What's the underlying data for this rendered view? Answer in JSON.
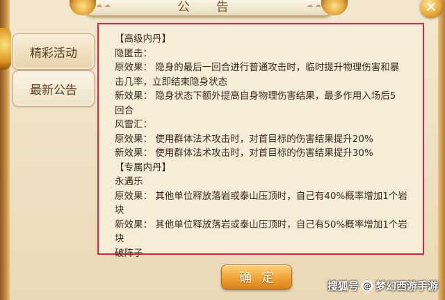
{
  "window": {
    "title": "公 告",
    "close_label": "✕"
  },
  "sidebar": {
    "tabs": [
      {
        "label": "精彩活动"
      },
      {
        "label": "最新公告"
      }
    ]
  },
  "content": {
    "lines": [
      "【高级内丹】",
      "隐匿击：",
      "原效果：  隐身的最后一回合进行普通攻击时，临时提升物理伤害和暴",
      "击几率，立即结束隐身状态",
      "新效果：  隐身状态下额外提高自身物理伤害结果，最多作用入场后5",
      "回合",
      "风雷汇：",
      "原效果：  使用群体法术攻击时，对首目标的伤害结果提升20%",
      "新效果：  使用群体法术攻击时，对首目标的伤害结果提升30%",
      "【专属内丹】",
      "永遇乐",
      "原效果：  其他单位释放落岩或泰山压顶时，自己有40%概率增加1个岩",
      "块",
      "新效果：  其他单位释放落岩或泰山压顶时，自己有50%概率增加1个岩",
      "块",
      "破阵子"
    ]
  },
  "footer": {
    "confirm_label": "确定"
  },
  "watermark": {
    "text_before": "搜狐号",
    "at": "@",
    "text_after": "梦幻西游手游"
  },
  "colors": {
    "highlight_border": "#e0253a",
    "button_orange": "#f0a234"
  }
}
